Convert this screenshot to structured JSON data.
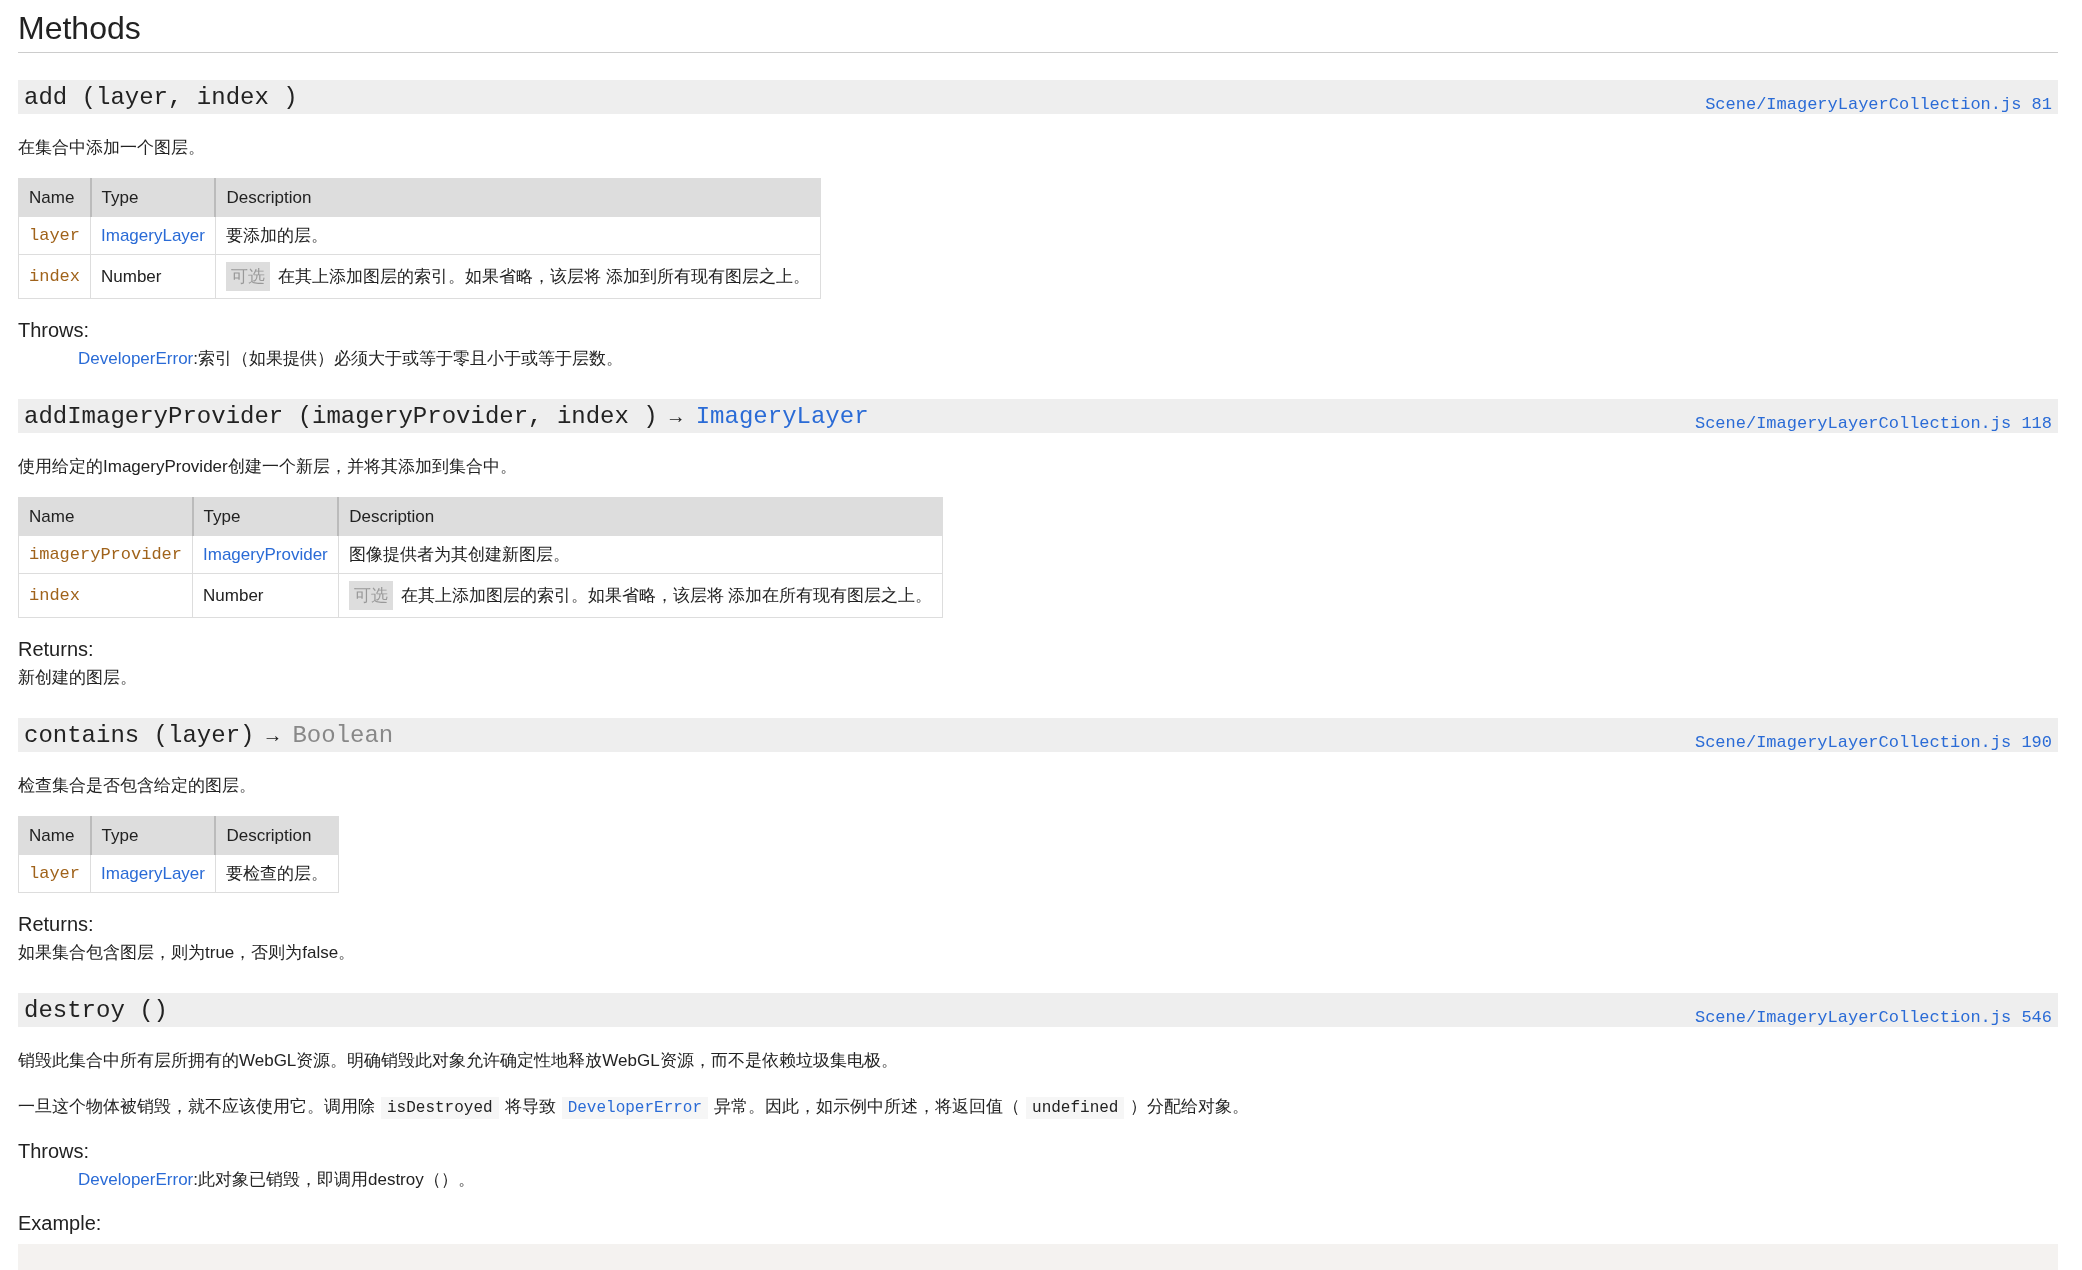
{
  "heading": "Methods",
  "methods": [
    {
      "signature": "add (layer, index )",
      "source": "Scene/ImageryLayerCollection.js 81",
      "description": [
        [
          {
            "kind": "text",
            "text": "在集合中添加一个图层。"
          }
        ]
      ],
      "params": {
        "columns": [
          "Name",
          "Type",
          "Description"
        ],
        "rows": [
          {
            "name": "layer",
            "type": "ImageryLayer",
            "kind": "link",
            "description": "要添加的层。"
          },
          {
            "name": "index",
            "type": "Number",
            "kind": "plain",
            "badge": "可选",
            "description": "在其上添加图层的索引。如果省略，该层将 添加到所有现有图层之上。"
          }
        ]
      },
      "sections": [
        {
          "kind": "throws",
          "label": "Throws:",
          "type": "DeveloperError",
          "text": ":索引（如果提供）必须大于或等于零且小于或等于层数。"
        }
      ]
    },
    {
      "signature": "addImageryProvider (imageryProvider, index )",
      "arrow": "→",
      "returns": {
        "text": "ImageryLayer",
        "kind": "link"
      },
      "source": "Scene/ImageryLayerCollection.js 118",
      "description": [
        [
          {
            "kind": "text",
            "text": "使用给定的ImageryProvider创建一个新层，并将其添加到集合中。"
          }
        ]
      ],
      "params": {
        "columns": [
          "Name",
          "Type",
          "Description"
        ],
        "rows": [
          {
            "name": "imageryProvider",
            "type": "ImageryProvider",
            "kind": "link",
            "description": "图像提供者为其创建新图层。"
          },
          {
            "name": "index",
            "type": "Number",
            "kind": "plain",
            "badge": "可选",
            "description": "在其上添加图层的索引。如果省略，该层将 添加在所有现有图层之上。"
          }
        ]
      },
      "sections": [
        {
          "kind": "returns",
          "label": "Returns:",
          "text": "新创建的图层。"
        }
      ]
    },
    {
      "signature": "contains (layer)",
      "arrow": "→",
      "returns": {
        "text": "Boolean",
        "kind": "plain"
      },
      "source": "Scene/ImageryLayerCollection.js 190",
      "description": [
        [
          {
            "kind": "text",
            "text": "检查集合是否包含给定的图层。"
          }
        ]
      ],
      "params": {
        "columns": [
          "Name",
          "Type",
          "Description"
        ],
        "rows": [
          {
            "name": "layer",
            "type": "ImageryLayer",
            "kind": "link",
            "description": "要检查的层。"
          }
        ]
      },
      "sections": [
        {
          "kind": "returns",
          "label": "Returns:",
          "text": "如果集合包含图层，则为true，否则为false。"
        }
      ]
    },
    {
      "signature": "destroy ()",
      "source": "Scene/ImageryLayerCollection.js 546",
      "description": [
        [
          {
            "kind": "text",
            "text": "销毁此集合中所有层所拥有的WebGL资源。明确销毁此对象允许确定性地释放WebGL资源，而不是依赖垃圾集电极。"
          }
        ],
        [
          {
            "kind": "text",
            "text": "一旦这个物体被销毁，就不应该使用它。调用除"
          },
          {
            "kind": "code",
            "text": "isDestroyed"
          },
          {
            "kind": "text",
            "text": "将导致"
          },
          {
            "kind": "code-link",
            "text": "DeveloperError"
          },
          {
            "kind": "text",
            "text": "异常。因此，如示例中所述，将返回值（"
          },
          {
            "kind": "code",
            "text": "undefined"
          },
          {
            "kind": "text",
            "text": "）分配给对象。"
          }
        ]
      ],
      "sections": [
        {
          "kind": "throws",
          "label": "Throws:",
          "type": "DeveloperError",
          "text": ":此对象已销毁，即调用destroy（）。"
        },
        {
          "kind": "example",
          "label": "Example:"
        }
      ]
    }
  ]
}
